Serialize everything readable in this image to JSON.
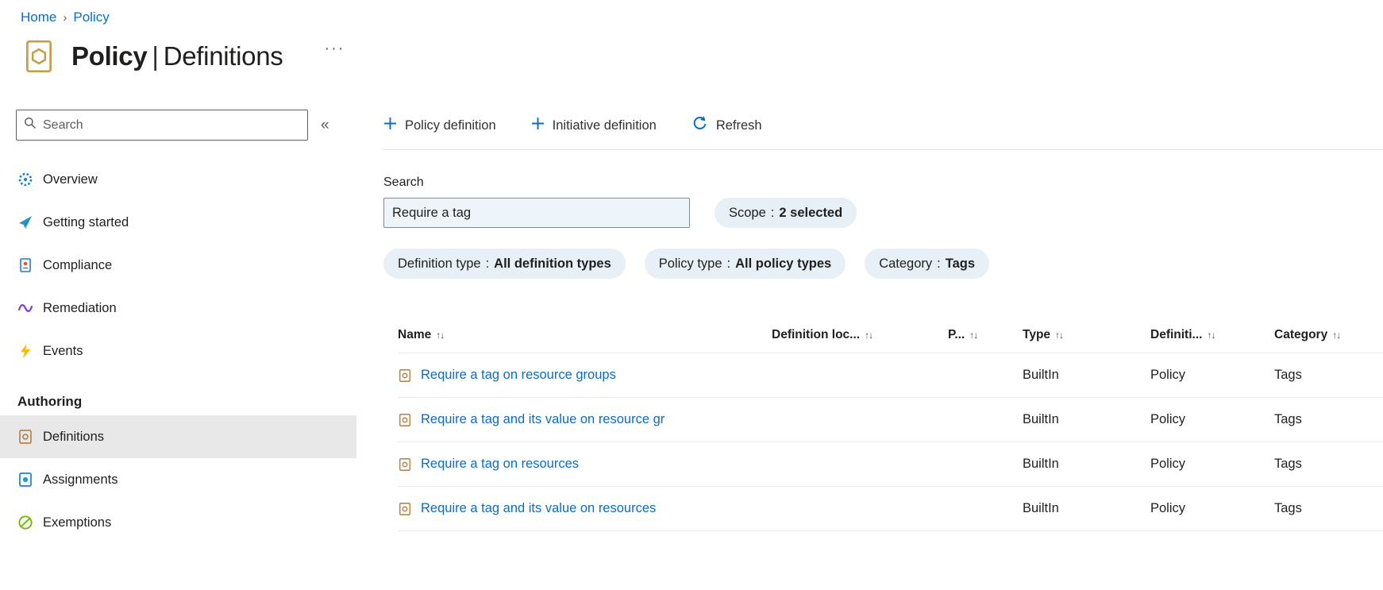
{
  "breadcrumb": {
    "separator": "›",
    "items": [
      {
        "label": "Home"
      },
      {
        "label": "Policy"
      }
    ]
  },
  "header": {
    "icon": "policy-icon",
    "title_primary": "Policy",
    "title_divider": "|",
    "title_secondary": "Definitions",
    "more_label": "···"
  },
  "sidebar": {
    "search": {
      "placeholder": "Search",
      "icon": "search-icon"
    },
    "collapse_glyph": "«",
    "items": [
      {
        "label": "Overview",
        "icon": "overview-icon"
      },
      {
        "label": "Getting started",
        "icon": "getting-started-icon"
      },
      {
        "label": "Compliance",
        "icon": "compliance-icon"
      },
      {
        "label": "Remediation",
        "icon": "remediation-icon"
      },
      {
        "label": "Events",
        "icon": "events-icon"
      }
    ],
    "section": {
      "title": "Authoring",
      "items": [
        {
          "label": "Definitions",
          "icon": "definitions-icon",
          "selected": true
        },
        {
          "label": "Assignments",
          "icon": "assignments-icon",
          "selected": false
        },
        {
          "label": "Exemptions",
          "icon": "exemptions-icon",
          "selected": false
        }
      ]
    }
  },
  "toolbar": {
    "buttons": [
      {
        "label": "Policy definition",
        "icon": "plus-icon"
      },
      {
        "label": "Initiative definition",
        "icon": "plus-icon"
      },
      {
        "label": "Refresh",
        "icon": "refresh-icon"
      }
    ]
  },
  "filters": {
    "search_label": "Search",
    "search_value": "Require a tag",
    "separator": ":",
    "pills": [
      {
        "name": "Scope",
        "value": "2 selected"
      },
      {
        "name": "Definition type",
        "value": "All definition types"
      },
      {
        "name": "Policy type",
        "value": "All policy types"
      },
      {
        "name": "Category",
        "value": "Tags"
      }
    ]
  },
  "table": {
    "sort_glyph": "↑↓",
    "columns": [
      {
        "label": "Name"
      },
      {
        "label": "Definition loc..."
      },
      {
        "label": "P..."
      },
      {
        "label": "Type"
      },
      {
        "label": "Definiti..."
      },
      {
        "label": "Category"
      }
    ],
    "rows": [
      {
        "name": "Require a tag on resource groups",
        "definition_location": "",
        "policies": "",
        "type": "BuiltIn",
        "definition_type": "Policy",
        "category": "Tags"
      },
      {
        "name": "Require a tag and its value on resource gr",
        "definition_location": "",
        "policies": "",
        "type": "BuiltIn",
        "definition_type": "Policy",
        "category": "Tags"
      },
      {
        "name": "Require a tag on resources",
        "definition_location": "",
        "policies": "",
        "type": "BuiltIn",
        "definition_type": "Policy",
        "category": "Tags"
      },
      {
        "name": "Require a tag and its value on resources",
        "definition_location": "",
        "policies": "",
        "type": "BuiltIn",
        "definition_type": "Policy",
        "category": "Tags"
      }
    ]
  }
}
